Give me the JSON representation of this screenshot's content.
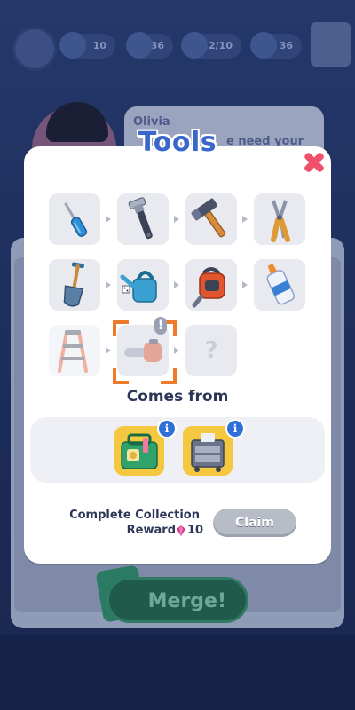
{
  "background": {
    "resources": [
      "10",
      "36",
      "2/10",
      "36"
    ],
    "speaker": "Olivia",
    "speech_partial": "e need your",
    "merge_label": "Merge!"
  },
  "modal": {
    "title": "Tools",
    "comes_from_label": "Comes from",
    "reward_label_line1": "Complete Collection",
    "reward_label_line2": "Reward",
    "reward_amount": "10",
    "claim_label": "Claim",
    "unknown_symbol": "?",
    "alert_symbol": "!",
    "info_symbol": "i"
  },
  "collection": [
    {
      "name": "screwdriver",
      "state": "unlocked"
    },
    {
      "name": "wrench",
      "state": "unlocked"
    },
    {
      "name": "hammer",
      "state": "unlocked"
    },
    {
      "name": "pliers",
      "state": "unlocked"
    },
    {
      "name": "shovel",
      "state": "unlocked"
    },
    {
      "name": "watering-can",
      "state": "unlocked"
    },
    {
      "name": "leaf-blower",
      "state": "unlocked"
    },
    {
      "name": "glue-bottle",
      "state": "unlocked"
    },
    {
      "name": "step-ladder",
      "state": "faded"
    },
    {
      "name": "chainsaw",
      "state": "faded-selected"
    },
    {
      "name": "unknown",
      "state": "locked"
    }
  ],
  "sources": [
    "toolbox",
    "tool-cart"
  ],
  "colors": {
    "title": "#3a67c9",
    "close": "#f0506a",
    "selection": "#ef7a2a",
    "info": "#2f6fd8",
    "source_bg": "#f5c842"
  }
}
